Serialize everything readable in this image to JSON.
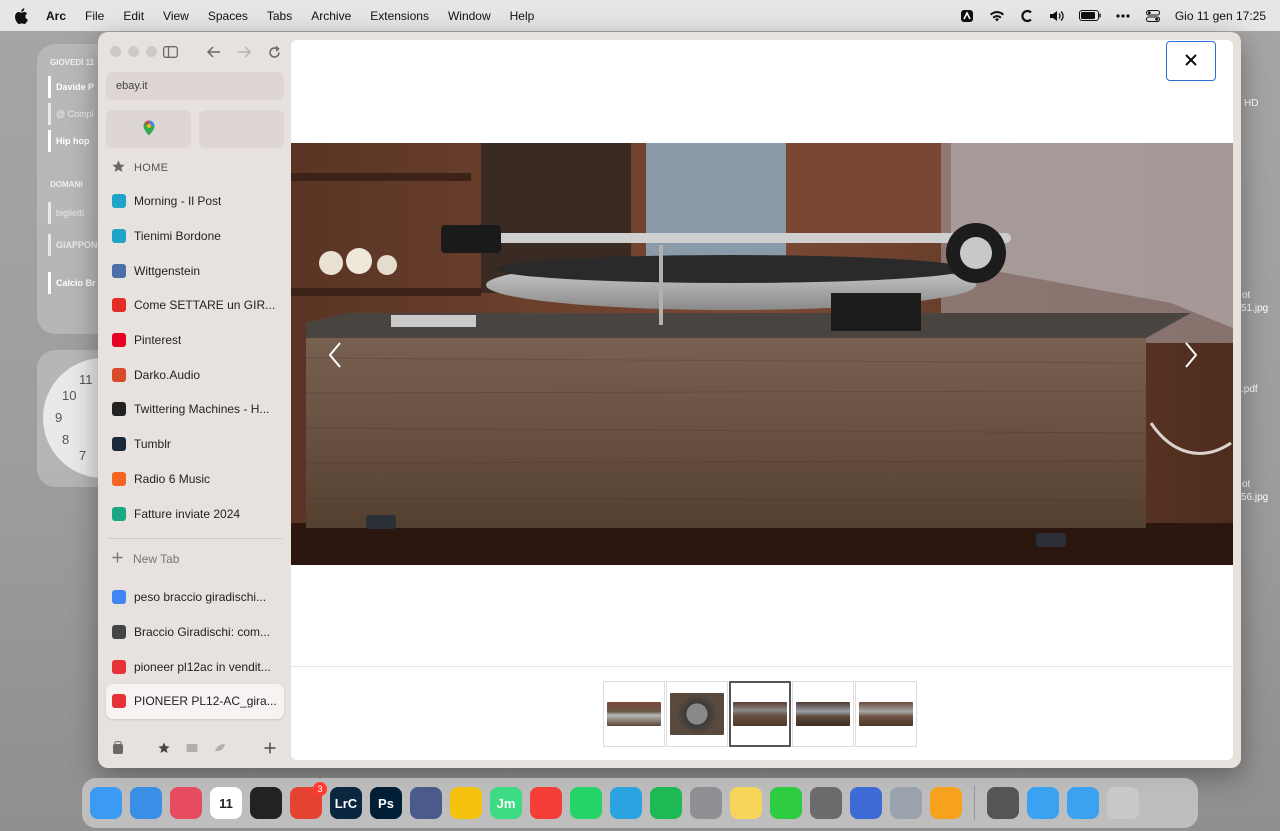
{
  "menubar": {
    "app_name": "Arc",
    "items": [
      "File",
      "Edit",
      "View",
      "Spaces",
      "Tabs",
      "Archive",
      "Extensions",
      "Window",
      "Help"
    ],
    "clock": "Gio 11 gen  17:25"
  },
  "widgets": {
    "calendar_day": "GIOVEDÌ 11",
    "event1": "Davide P",
    "event2": "@ Compl",
    "event3": "Hip hop",
    "tomorrow": "DOMANI",
    "event4": "biglietti",
    "event5": "GIAPPON",
    "event6": "Calcio Br",
    "clock_nums": [
      "11",
      "10",
      "9",
      "8",
      "7"
    ]
  },
  "desktop_labels": {
    "hd": "HD",
    "file1a": "ot",
    "file1b": "51.jpg",
    "file2": ".pdf",
    "file3a": "ot",
    "file3b": "56.jpg"
  },
  "sidebar": {
    "url": "ebay.it",
    "section_title": "HOME",
    "pinned": [
      {
        "title": "Morning - Il Post",
        "icon": "il-post-icon",
        "color": "#1fa3c9"
      },
      {
        "title": "Tienimi Bordone",
        "icon": "il-post-icon",
        "color": "#1fa3c9"
      },
      {
        "title": "Wittgenstein",
        "icon": "wikipedia-icon",
        "color": "#4a6ea9"
      },
      {
        "title": "Come SETTARE un GIR...",
        "icon": "youtube-icon",
        "color": "#e52d27"
      },
      {
        "title": "Pinterest",
        "icon": "pinterest-icon",
        "color": "#e60023"
      },
      {
        "title": "Darko.Audio",
        "icon": "darko-audio-icon",
        "color": "#d94a2b"
      },
      {
        "title": "Twittering Machines - H...",
        "icon": "twittering-machines-icon",
        "color": "#222222"
      },
      {
        "title": "Tumblr",
        "icon": "tumblr-icon",
        "color": "#1b2a3b"
      },
      {
        "title": "Radio 6 Music",
        "icon": "bbc-sounds-icon",
        "color": "#f26522"
      },
      {
        "title": "Fatture inviate 2024",
        "icon": "spreadsheet-icon",
        "color": "#1ba784"
      }
    ],
    "new_tab_label": "New Tab",
    "tabs": [
      {
        "title": "peso braccio giradischi...",
        "icon": "google-icon",
        "color": "#4285f4"
      },
      {
        "title": "Braccio Giradischi: com...",
        "icon": "audio-review-icon",
        "color": "#444444"
      },
      {
        "title": "pioneer pl12ac in vendit...",
        "icon": "ebay-icon",
        "color": "#e53238"
      },
      {
        "title": "PIONEER PL12-AC_gira...",
        "icon": "ebay-icon",
        "color": "#e53238"
      }
    ]
  },
  "viewer": {
    "thumbnails": 5,
    "selected_index": 2
  },
  "dock": {
    "badge_count": "3",
    "apps": [
      {
        "name": "finder-icon",
        "color": "#3b9bf2",
        "label": ""
      },
      {
        "name": "mail-icon",
        "color": "#3a8ee6",
        "label": ""
      },
      {
        "name": "arc-icon",
        "color": "#e74b5f",
        "label": ""
      },
      {
        "name": "calendar-icon",
        "color": "#ffffff",
        "label": "11"
      },
      {
        "name": "speedometer-icon",
        "color": "#222222",
        "label": ""
      },
      {
        "name": "todoist-icon",
        "color": "#e44332",
        "label": ""
      },
      {
        "name": "lightroom-classic-icon",
        "color": "#0b2740",
        "label": "LrC"
      },
      {
        "name": "photoshop-icon",
        "color": "#001e36",
        "label": "Ps"
      },
      {
        "name": "aperture-icon",
        "color": "#4a5a8a",
        "label": ""
      },
      {
        "name": "sync-icon",
        "color": "#f4c20d",
        "label": ""
      },
      {
        "name": "jm-icon",
        "color": "#3ddc84",
        "label": "Jm"
      },
      {
        "name": "pocket-casts-icon",
        "color": "#f43e37",
        "label": ""
      },
      {
        "name": "whatsapp-icon",
        "color": "#25d366",
        "label": ""
      },
      {
        "name": "telegram-icon",
        "color": "#2aa3e0",
        "label": ""
      },
      {
        "name": "spotify-icon",
        "color": "#1db954",
        "label": ""
      },
      {
        "name": "system-settings-icon",
        "color": "#8e8e93",
        "label": ""
      },
      {
        "name": "notes-icon",
        "color": "#f7d55a",
        "label": ""
      },
      {
        "name": "facetime-icon",
        "color": "#2ecc40",
        "label": ""
      },
      {
        "name": "screenshot-icon",
        "color": "#6b6b6b",
        "label": ""
      },
      {
        "name": "preview-icon",
        "color": "#3c6bd6",
        "label": ""
      },
      {
        "name": "finder-window-icon",
        "color": "#9aa3ad",
        "label": ""
      },
      {
        "name": "pencil-icon",
        "color": "#f7a21c",
        "label": ""
      }
    ],
    "right_items": [
      {
        "name": "camera-icon",
        "color": "#555555"
      },
      {
        "name": "applications-folder-icon",
        "color": "#3ba2f2"
      },
      {
        "name": "downloads-folder-icon",
        "color": "#3ba2f2"
      },
      {
        "name": "trash-icon",
        "color": "#c9c9c9"
      }
    ]
  }
}
